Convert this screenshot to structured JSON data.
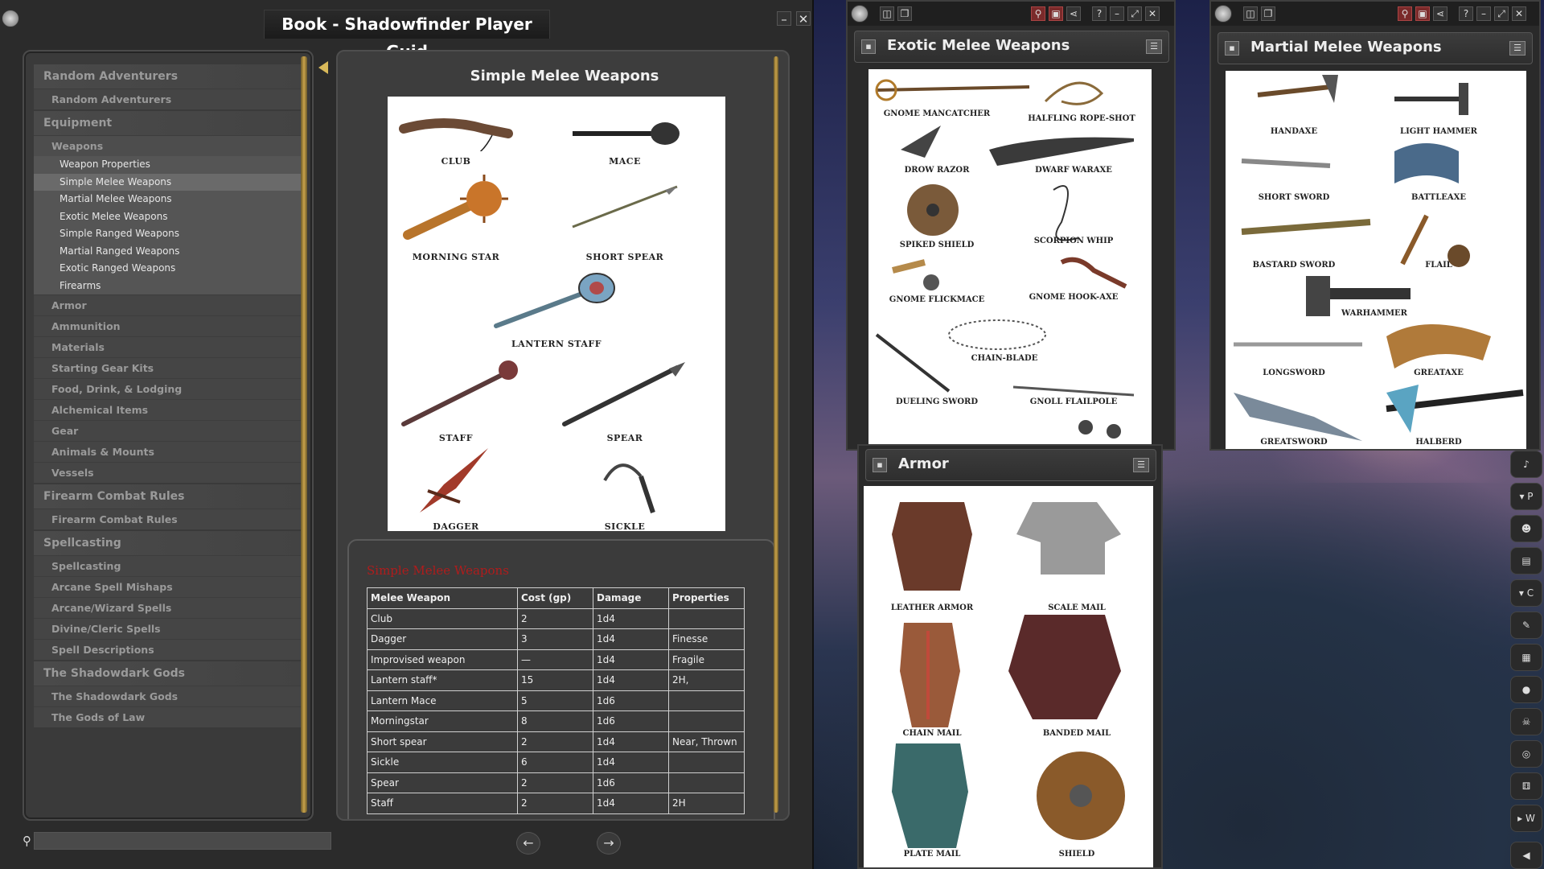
{
  "book": {
    "title": "Book - Shadowfinder Player Guid",
    "toc": [
      {
        "level": 1,
        "label": "Random Adventurers"
      },
      {
        "level": 2,
        "label": "Random Adventurers"
      },
      {
        "level": 1,
        "label": "Equipment"
      },
      {
        "level": 2,
        "label": "Weapons",
        "sub": true
      },
      {
        "level": 3,
        "label": "Weapon Properties"
      },
      {
        "level": 3,
        "label": "Simple Melee Weapons",
        "active": true
      },
      {
        "level": 3,
        "label": "Martial Melee Weapons"
      },
      {
        "level": 3,
        "label": "Exotic Melee Weapons"
      },
      {
        "level": 3,
        "label": "Simple Ranged Weapons"
      },
      {
        "level": 3,
        "label": "Martial Ranged Weapons"
      },
      {
        "level": 3,
        "label": "Exotic Ranged Weapons"
      },
      {
        "level": 3,
        "label": "Firearms"
      },
      {
        "level": 2,
        "label": "Armor"
      },
      {
        "level": 2,
        "label": "Ammunition"
      },
      {
        "level": 2,
        "label": "Materials"
      },
      {
        "level": 2,
        "label": "Starting Gear Kits"
      },
      {
        "level": 2,
        "label": "Food, Drink, & Lodging"
      },
      {
        "level": 2,
        "label": "Alchemical Items"
      },
      {
        "level": 2,
        "label": "Gear"
      },
      {
        "level": 2,
        "label": "Animals & Mounts"
      },
      {
        "level": 2,
        "label": "Vessels"
      },
      {
        "level": 1,
        "label": "Firearm Combat Rules"
      },
      {
        "level": 2,
        "label": "Firearm Combat Rules"
      },
      {
        "level": 1,
        "label": "Spellcasting"
      },
      {
        "level": 2,
        "label": "Spellcasting"
      },
      {
        "level": 2,
        "label": "Arcane Spell Mishaps"
      },
      {
        "level": 2,
        "label": "Arcane/Wizard Spells"
      },
      {
        "level": 2,
        "label": "Divine/Cleric Spells"
      },
      {
        "level": 2,
        "label": "Spell Descriptions"
      },
      {
        "level": 1,
        "label": "The Shadowdark Gods"
      },
      {
        "level": 2,
        "label": "The Shadowdark Gods"
      },
      {
        "level": 2,
        "label": "The Gods of Law"
      }
    ],
    "search_value": ""
  },
  "content": {
    "heading": "Simple Melee Weapons",
    "weapons": [
      "CLUB",
      "MACE",
      "MORNING STAR",
      "SHORT SPEAR",
      "LANTERN STAFF",
      "STAFF",
      "SPEAR",
      "DAGGER",
      "SICKLE"
    ],
    "table_title": "Simple Melee Weapons",
    "table_headers": [
      "Melee Weapon",
      "Cost (gp)",
      "Damage",
      "Properties"
    ],
    "table_rows": [
      [
        "Club",
        "2",
        "1d4",
        ""
      ],
      [
        "Dagger",
        "3",
        "1d4",
        "Finesse"
      ],
      [
        "Improvised weapon",
        "—",
        "1d4",
        "Fragile"
      ],
      [
        "Lantern staff*",
        "15",
        "1d4",
        "2H,"
      ],
      [
        "Lantern Mace",
        "5",
        "1d6",
        ""
      ],
      [
        "Morningstar",
        "8",
        "1d6",
        ""
      ],
      [
        "Short spear",
        "2",
        "1d4",
        "Near, Thrown"
      ],
      [
        "Sickle",
        "6",
        "1d4",
        ""
      ],
      [
        "Spear",
        "2",
        "1d6",
        ""
      ],
      [
        "Staff",
        "2",
        "1d4",
        "2H"
      ]
    ]
  },
  "exotic": {
    "title": "Exotic Melee Weapons",
    "items": [
      "GNOME MANCATCHER",
      "HALFLING ROPE-SHOT",
      "DROW RAZOR",
      "DWARF WARAXE",
      "SPIKED SHIELD",
      "SCORPION WHIP",
      "GNOME FLICKMACE",
      "GNOME HOOK-AXE",
      "CHAIN-BLADE",
      "DUELING SWORD",
      "GNOLL FLAILPOLE"
    ]
  },
  "martial": {
    "title": "Martial Melee Weapons",
    "items": [
      "HANDAXE",
      "LIGHT HAMMER",
      "SHORT SWORD",
      "BATTLEAXE",
      "BASTARD SWORD",
      "FLAIL",
      "WARHAMMER",
      "LONGSWORD",
      "GREATAXE",
      "GREATSWORD",
      "HALBERD"
    ]
  },
  "armor": {
    "title": "Armor",
    "items": [
      "LEATHER ARMOR",
      "SCALE MAIL",
      "CHAIN MAIL",
      "BANDED MAIL",
      "PLATE MAIL",
      "SHIELD"
    ]
  },
  "dock": [
    "▾ P",
    "▾ C",
    "▸ W"
  ],
  "colors": {
    "table_title": "#b01c1c",
    "gold_rail": "#c9a24a"
  }
}
